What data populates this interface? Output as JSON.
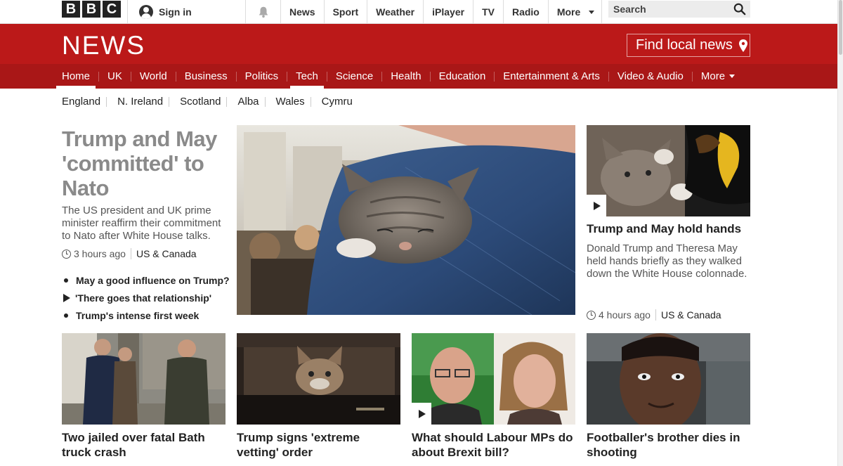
{
  "brand": {
    "bbc_letters": [
      "B",
      "B",
      "C"
    ],
    "news_logo": "NEWS",
    "red": "#bb1919",
    "dark_red": "#a91717"
  },
  "topbar": {
    "signin": "Sign in",
    "nav": [
      "News",
      "Sport",
      "Weather",
      "iPlayer",
      "TV",
      "Radio",
      "More"
    ],
    "search_placeholder": "Search"
  },
  "masthead": {
    "local_news": "Find local news"
  },
  "main_nav": {
    "items": [
      "Home",
      "UK",
      "World",
      "Business",
      "Politics",
      "Tech",
      "Science",
      "Health",
      "Education",
      "Entertainment & Arts",
      "Video & Audio",
      "More"
    ],
    "active": "Home"
  },
  "sub_nav": [
    "England",
    "N. Ireland",
    "Scotland",
    "Alba",
    "Wales",
    "Cymru"
  ],
  "lead": {
    "title": "Trump and May 'committed' to Nato",
    "summary": "The US president and UK prime minister reaffirm their commitment to Nato after White House talks.",
    "time": "3 hours ago",
    "section": "US & Canada",
    "related": [
      {
        "text": "May a good influence on Trump?",
        "type": "bullet"
      },
      {
        "text": "'There goes that relationship'",
        "type": "video"
      },
      {
        "text": "Trump's intense first week",
        "type": "bullet"
      }
    ]
  },
  "side": {
    "title": "Trump and May hold hands",
    "summary": "Donald Trump and Theresa May held hands briefly as they walked down the White House colonnade.",
    "time": "4 hours ago",
    "section": "US & Canada"
  },
  "cards": [
    {
      "title": "Two jailed over fatal Bath truck crash"
    },
    {
      "title": "Trump signs 'extreme vetting' order"
    },
    {
      "title": "What should Labour MPs do about Brexit bill?"
    },
    {
      "title": "Footballer's brother dies in shooting"
    }
  ],
  "icons": {
    "signin": "user-icon",
    "notifications": "bell-icon",
    "search": "search-icon",
    "location": "location-pin-icon",
    "time": "clock-icon",
    "video": "play-icon"
  }
}
